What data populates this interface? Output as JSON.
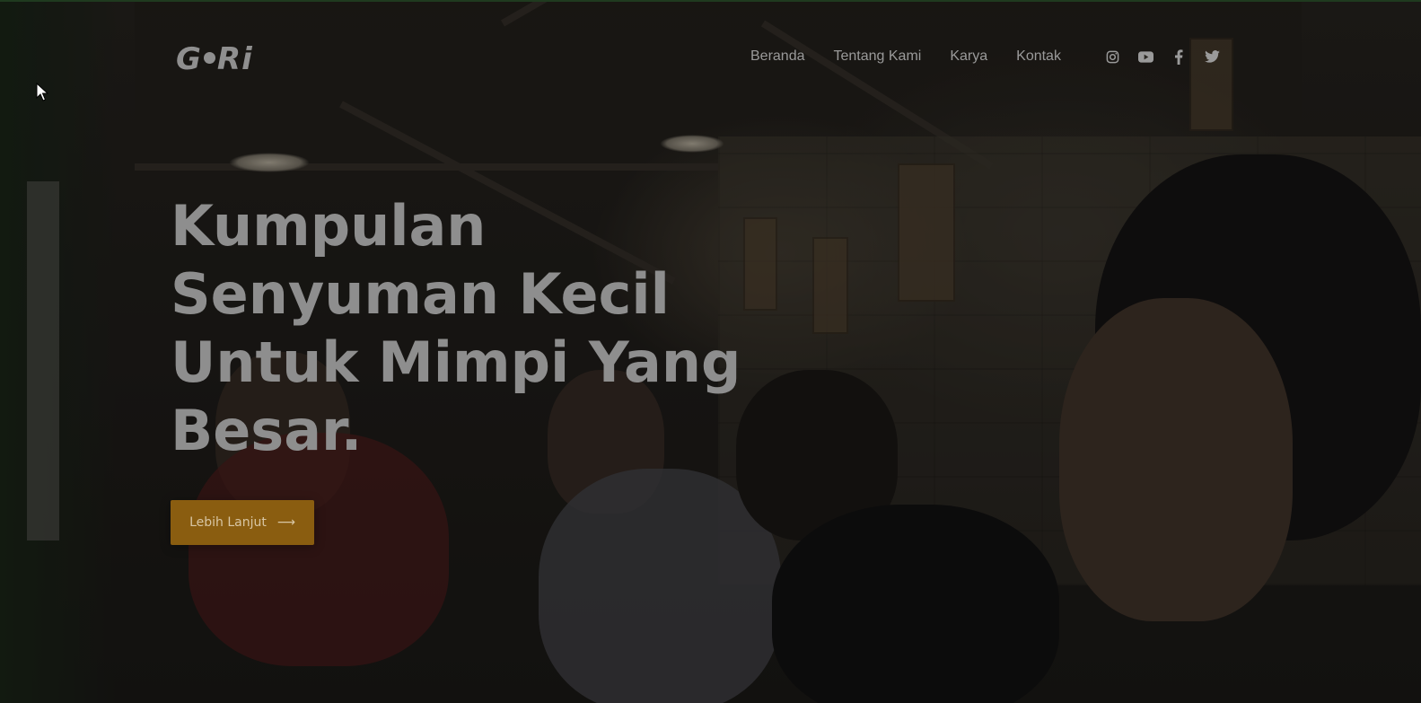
{
  "brand": {
    "logo_text_left": "G",
    "logo_text_right": "Ri"
  },
  "nav": {
    "items": [
      {
        "label": "Beranda"
      },
      {
        "label": "Tentang Kami"
      },
      {
        "label": "Karya"
      },
      {
        "label": "Kontak"
      }
    ]
  },
  "social": {
    "icons": [
      "instagram-icon",
      "youtube-icon",
      "facebook-icon",
      "twitter-icon"
    ]
  },
  "hero": {
    "headline_lines": [
      "Kumpulan",
      "Senyuman Kecil",
      "Untuk Mimpi Yang",
      "Besar."
    ],
    "cta_label": "Lebih Lanjut",
    "cta_arrow": "⟶"
  },
  "colors": {
    "accent": "#8a5d10",
    "text": "#8e8e8e",
    "nav_text": "#9a9a9a"
  }
}
